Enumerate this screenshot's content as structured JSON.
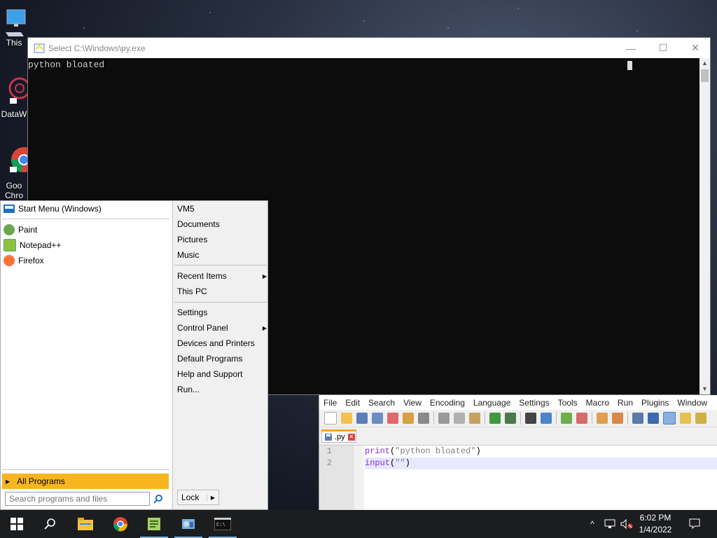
{
  "desktop": {
    "icons": [
      {
        "label": "This",
        "icon": "this-pc-icon"
      },
      {
        "label": "DataW",
        "icon": "datawrapper-icon"
      },
      {
        "label": "Goo\nChro",
        "label_line1": "Goo",
        "label_line2": "Chro",
        "icon": "chrome-icon"
      }
    ]
  },
  "console": {
    "title": "Select C:\\Windows\\py.exe",
    "output": "python bloated",
    "buttons": {
      "minimize": "—",
      "maximize": "☐",
      "close": "✕"
    }
  },
  "start_menu": {
    "header": "Start Menu (Windows)",
    "pinned": [
      {
        "label": "Paint",
        "icon": "paint-icon",
        "color": "#6aa84f"
      },
      {
        "label": "Notepad++",
        "icon": "notepadpp-icon",
        "color": "#8fbf3f"
      },
      {
        "label": "Firefox",
        "icon": "firefox-icon",
        "color": "#ff7139"
      }
    ],
    "all_programs": "All Programs",
    "search_placeholder": "Search programs and files",
    "right": {
      "group1": [
        "VM5",
        "Documents",
        "Pictures",
        "Music"
      ],
      "group2": [
        {
          "label": "Recent Items",
          "submenu": true
        },
        {
          "label": "This PC",
          "submenu": false
        }
      ],
      "group3": [
        {
          "label": "Settings",
          "submenu": false
        },
        {
          "label": "Control Panel",
          "submenu": true
        },
        {
          "label": "Devices and Printers",
          "submenu": false
        },
        {
          "label": "Default Programs",
          "submenu": false
        },
        {
          "label": "Help and Support",
          "submenu": false
        },
        {
          "label": "Run...",
          "submenu": false
        }
      ],
      "lock": "Lock"
    },
    "accent": "#f7b520"
  },
  "notepadpp": {
    "menu": [
      "File",
      "Edit",
      "Search",
      "View",
      "Encoding",
      "Language",
      "Settings",
      "Tools",
      "Macro",
      "Run",
      "Plugins",
      "Window"
    ],
    "tab": ".py",
    "lines": [
      {
        "num": "1",
        "fn": "print",
        "open": "(",
        "str": "\"python bloated\"",
        "close": ")"
      },
      {
        "num": "2",
        "fn": "input",
        "open": "(",
        "str": "\"\"",
        "close": ")"
      }
    ]
  },
  "taskbar": {
    "items": [
      "start-icon",
      "search-icon",
      "file-explorer-icon",
      "chrome-icon",
      "notepadpp-icon",
      "control-panel-icon",
      "console-icon"
    ],
    "time": "6:02 PM",
    "date": "1/4/2022"
  }
}
